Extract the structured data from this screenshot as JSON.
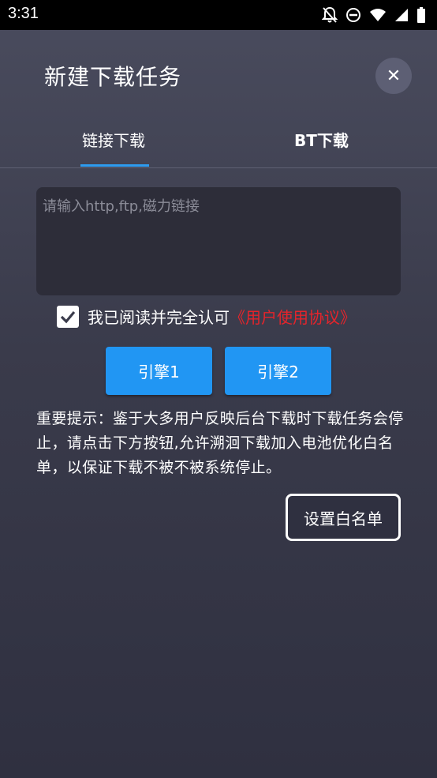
{
  "status_bar": {
    "time": "3:31",
    "icons": [
      "notifications-off-icon",
      "do-not-disturb-icon",
      "wifi-icon",
      "cellular-signal-icon",
      "battery-icon"
    ]
  },
  "dialog": {
    "title": "新建下载任务",
    "close_icon": "close-icon"
  },
  "tabs": [
    {
      "label": "链接下载",
      "active": true
    },
    {
      "label": "BT下载",
      "active": false
    }
  ],
  "link_input": {
    "placeholder": "请输入http,ftp,磁力链接",
    "value": ""
  },
  "agreement": {
    "checked": true,
    "text": "我已阅读并完全认可",
    "link": "《用户使用协议》"
  },
  "engines": {
    "engine1": "引擎1",
    "engine2": "引擎2"
  },
  "notice": "重要提示：鉴于大多用户反映后台下载时下载任务会停止，请点击下方按钮,允许溯洄下载加入电池优化白名单，以保证下载不被不被系统停止。",
  "whitelist_button": "设置白名单",
  "colors": {
    "accent": "#2196f3",
    "tab_indicator": "#2d9cf0",
    "agreement_link": "#e5242b"
  }
}
